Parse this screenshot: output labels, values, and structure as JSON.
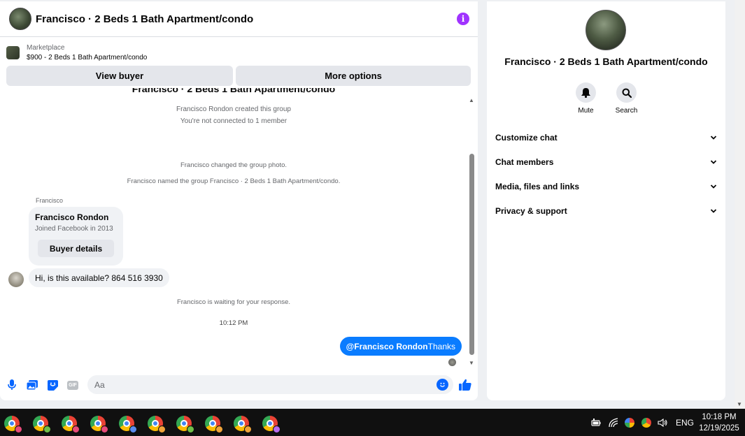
{
  "chat": {
    "title": "Francisco · 2 Beds 1 Bath Apartment/condo",
    "info_icon": "i",
    "marketplace_label": "Marketplace",
    "listing": "$900 - 2 Beds 1 Bath Apartment/condo",
    "view_buyer": "View buyer",
    "more_options": "More options"
  },
  "messages": {
    "group_title": "Francisco · 2 Beds 1 Bath Apartment/condo",
    "created": "Francisco Rondon created this group",
    "not_connected": "You're not connected to 1 member",
    "changed_photo": "Francisco changed the group photo.",
    "named_group": "Francisco named the group Francisco · 2 Beds 1 Bath Apartment/condo.",
    "sender": "Francisco",
    "profile_name": "Francisco Rondon",
    "profile_joined": "Joined Facebook in 2013",
    "buyer_details": "Buyer details",
    "incoming_text": "Hi, is this available? 864 516 3930",
    "waiting": "Francisco is waiting for your response.",
    "timestamp": "10:12 PM",
    "outgoing_mention": "@Francisco Rondon",
    "outgoing_text": "Thanks"
  },
  "composer": {
    "placeholder": "Aa",
    "icons": [
      "microphone-icon",
      "photo-icon",
      "sticker-icon",
      "gif-icon",
      "emoji-icon",
      "thumbs-up-icon"
    ],
    "gif_label": "GIF"
  },
  "info_panel": {
    "title": "Francisco · 2 Beds 1 Bath Apartment/condo",
    "actions": [
      {
        "label": "Mute",
        "icon": "bell-icon"
      },
      {
        "label": "Search",
        "icon": "search-icon"
      }
    ],
    "sections": [
      {
        "label": "Customize chat"
      },
      {
        "label": "Chat members"
      },
      {
        "label": "Media, files and links"
      },
      {
        "label": "Privacy & support"
      }
    ]
  },
  "taskbar": {
    "apps": [
      "chrome-profile-1",
      "chrome-profile-2",
      "chrome-profile-3",
      "chrome-profile-4",
      "chrome-profile-5",
      "chrome-profile-6",
      "chrome-profile-7",
      "chrome-profile-8",
      "chrome-profile-9",
      "chrome-profile-10"
    ],
    "language": "ENG",
    "time": "10:18 PM",
    "date": "12/19/2025"
  },
  "colors": {
    "accent": "#0866ff",
    "outgoing_bubble": "#0a7cff",
    "info_icon": "#a033ff",
    "bubble_gray": "#f0f2f5",
    "button_gray": "#e4e6eb"
  }
}
